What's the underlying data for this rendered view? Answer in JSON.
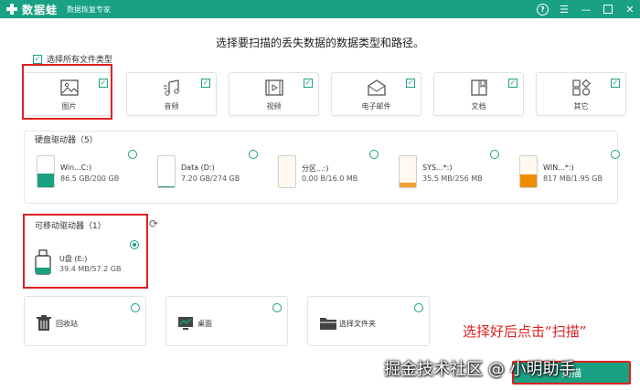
{
  "app": {
    "name": "数据蛙",
    "subtitle": "数据恢复专家"
  },
  "heading": "选择要扫描的丢失数据的数据类型和路径。",
  "select_all": {
    "label": "选择所有文件类型",
    "checked": true
  },
  "file_types": [
    {
      "label": "图片",
      "icon": "image-icon",
      "checked": true
    },
    {
      "label": "音频",
      "icon": "music-icon",
      "checked": true
    },
    {
      "label": "视频",
      "icon": "video-icon",
      "checked": true
    },
    {
      "label": "电子邮件",
      "icon": "mail-icon",
      "checked": true
    },
    {
      "label": "文档",
      "icon": "document-icon",
      "checked": true
    },
    {
      "label": "其它",
      "icon": "other-icon",
      "checked": true
    }
  ],
  "hard_drives": {
    "title": "硬盘驱动器（5）",
    "items": [
      {
        "name": "Win...C:)",
        "size": "86.5 GB/200 GB",
        "fill": 0.43,
        "color": "#1aa083"
      },
      {
        "name": "Data (D:)",
        "size": "7.20 GB/274 GB",
        "fill": 0.03,
        "color": "#1aa083"
      },
      {
        "name": "分区...:)",
        "size": "0.00  B/16.0 MB",
        "fill": 0.0,
        "color": "#f0a030"
      },
      {
        "name": "SYS...*:)",
        "size": "35.5 MB/256 MB",
        "fill": 0.14,
        "color": "#f0a030"
      },
      {
        "name": "WIN...*:)",
        "size": "817 MB/1.95 GB",
        "fill": 0.42,
        "color": "#f08c00"
      }
    ]
  },
  "removable": {
    "title": "可移动驱动器（1）",
    "items": [
      {
        "name": "U盘 (E:)",
        "size": "39.4 MB/57.2 GB",
        "selected": true
      }
    ]
  },
  "locations": [
    {
      "label": "回收站",
      "icon": "trash-icon"
    },
    {
      "label": "桌面",
      "icon": "desktop-icon"
    },
    {
      "label": "选择文件夹",
      "icon": "folder-icon"
    }
  ],
  "annotation": "选择好后点击“扫描”",
  "scan_button": "扫描",
  "watermark": "掘金技术社区 @ 小明助手",
  "colors": {
    "accent": "#1aa083",
    "highlight": "#e02020"
  }
}
